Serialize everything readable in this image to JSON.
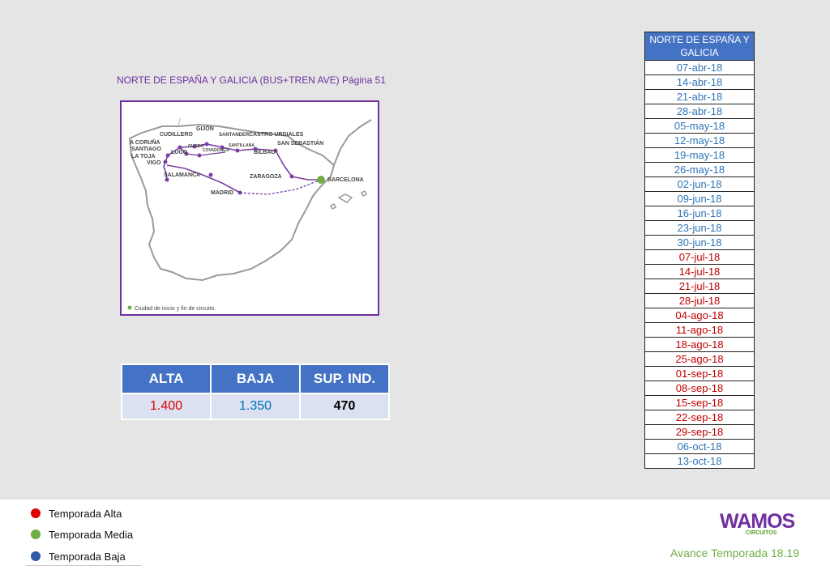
{
  "map": {
    "title": "NORTE DE ESPAÑA Y GALICIA (BUS+TREN AVE) Página 51",
    "cities": [
      "A CORUÑA",
      "SANTIAGO",
      "LA TOJA",
      "VIGO",
      "CUDILLERO",
      "LUGO",
      "GIJÓN",
      "OVIEDO",
      "COVADONGA",
      "SANTANDER",
      "SANTILLANA",
      "CASTRO URDIALES",
      "BILBAO",
      "SAN SEBASTIÁN",
      "SALAMANCA",
      "MADRID",
      "ZARAGOZA",
      "BARCELONA"
    ],
    "legend": "Ciudad de inicio y fin de circuito."
  },
  "prices": {
    "headers": [
      "ALTA",
      "BAJA",
      "SUP. IND."
    ],
    "alta": "1.400",
    "baja": "1.350",
    "sup": "470"
  },
  "dates": {
    "header": "NORTE DE ESPAÑA Y GALICIA",
    "rows": [
      {
        "d": "07-abr-18",
        "s": "low"
      },
      {
        "d": "14-abr-18",
        "s": "low"
      },
      {
        "d": "21-abr-18",
        "s": "low"
      },
      {
        "d": "28-abr-18",
        "s": "low"
      },
      {
        "d": "05-may-18",
        "s": "low"
      },
      {
        "d": "12-may-18",
        "s": "low"
      },
      {
        "d": "19-may-18",
        "s": "low"
      },
      {
        "d": "26-may-18",
        "s": "low"
      },
      {
        "d": "02-jun-18",
        "s": "low"
      },
      {
        "d": "09-jun-18",
        "s": "low"
      },
      {
        "d": "16-jun-18",
        "s": "low"
      },
      {
        "d": "23-jun-18",
        "s": "low"
      },
      {
        "d": "30-jun-18",
        "s": "low"
      },
      {
        "d": "07-jul-18",
        "s": "high"
      },
      {
        "d": "14-jul-18",
        "s": "high"
      },
      {
        "d": "21-jul-18",
        "s": "high"
      },
      {
        "d": "28-jul-18",
        "s": "high"
      },
      {
        "d": "04-ago-18",
        "s": "high"
      },
      {
        "d": "11-ago-18",
        "s": "high"
      },
      {
        "d": "18-ago-18",
        "s": "high"
      },
      {
        "d": "25-ago-18",
        "s": "high"
      },
      {
        "d": "01-sep-18",
        "s": "high"
      },
      {
        "d": "08-sep-18",
        "s": "high"
      },
      {
        "d": "15-sep-18",
        "s": "high"
      },
      {
        "d": "22-sep-18",
        "s": "high"
      },
      {
        "d": "29-sep-18",
        "s": "high"
      },
      {
        "d": "06-oct-18",
        "s": "low"
      },
      {
        "d": "13-oct-18",
        "s": "low"
      }
    ]
  },
  "legend": {
    "alta": "Temporada Alta",
    "media": "Temporada Media",
    "baja": "Temporada Baja"
  },
  "colors": {
    "alta": "#e00000",
    "media": "#70ad47",
    "baja": "#2e5ca8",
    "accent": "#7030a0",
    "header": "#4472c4"
  },
  "brand": {
    "name": "WAMOS",
    "sub": "CIRCUITOS",
    "season": "Avance Temporada 18.19"
  }
}
